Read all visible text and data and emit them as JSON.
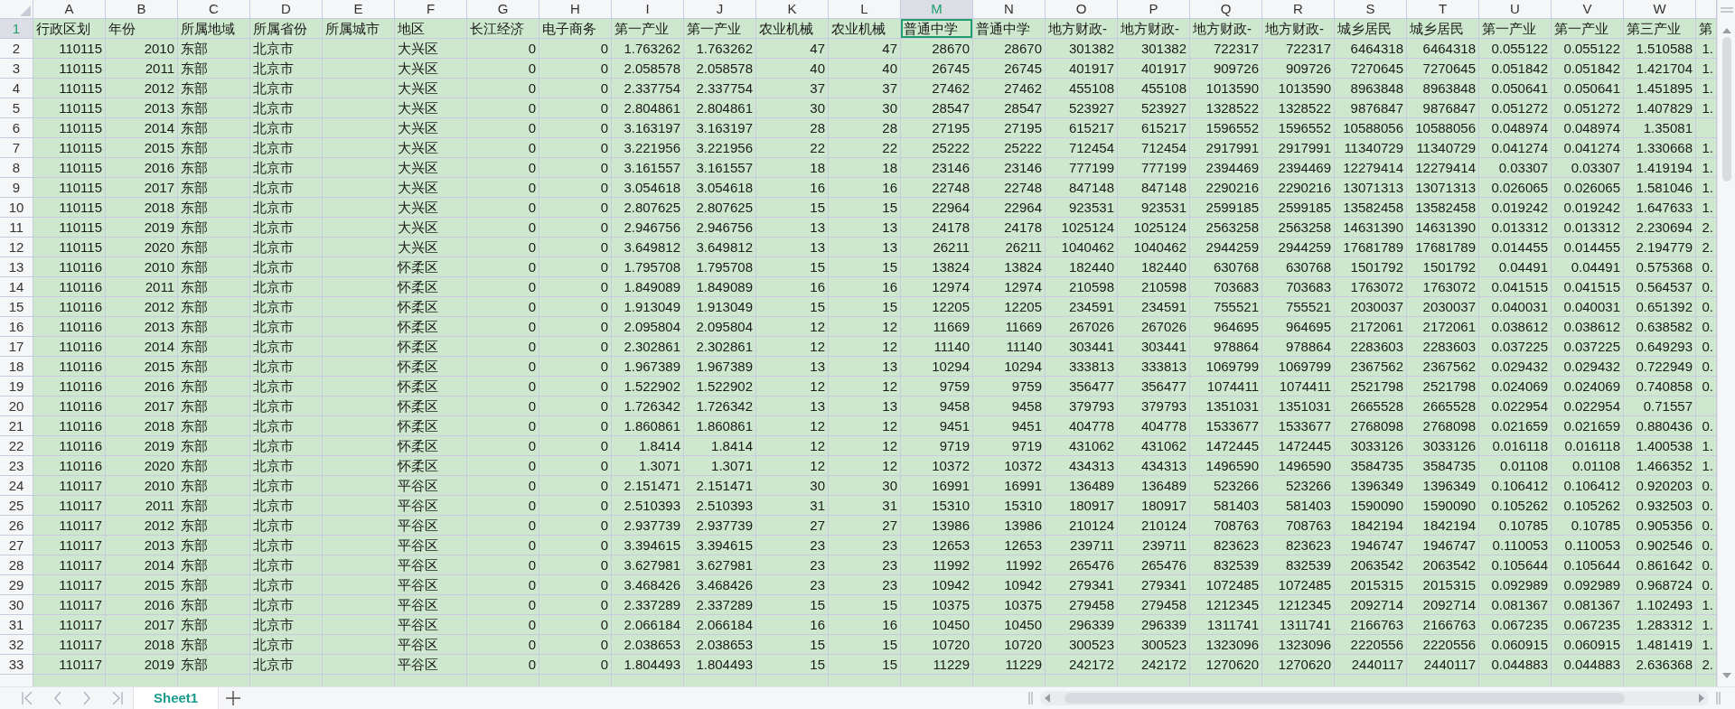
{
  "columns": [
    {
      "letter": "A",
      "kind": "number",
      "selected": false
    },
    {
      "letter": "B",
      "kind": "number",
      "selected": false
    },
    {
      "letter": "C",
      "kind": "text",
      "selected": false
    },
    {
      "letter": "D",
      "kind": "text",
      "selected": false
    },
    {
      "letter": "E",
      "kind": "text",
      "selected": false
    },
    {
      "letter": "F",
      "kind": "text",
      "selected": false
    },
    {
      "letter": "G",
      "kind": "number",
      "selected": false
    },
    {
      "letter": "H",
      "kind": "number",
      "selected": false
    },
    {
      "letter": "I",
      "kind": "number",
      "selected": false
    },
    {
      "letter": "J",
      "kind": "number",
      "selected": false
    },
    {
      "letter": "K",
      "kind": "number",
      "selected": false
    },
    {
      "letter": "L",
      "kind": "number",
      "selected": false
    },
    {
      "letter": "M",
      "kind": "number",
      "selected": true
    },
    {
      "letter": "N",
      "kind": "number",
      "selected": false
    },
    {
      "letter": "O",
      "kind": "number",
      "selected": false
    },
    {
      "letter": "P",
      "kind": "number",
      "selected": false
    },
    {
      "letter": "Q",
      "kind": "number",
      "selected": false
    },
    {
      "letter": "R",
      "kind": "number",
      "selected": false
    },
    {
      "letter": "S",
      "kind": "number",
      "selected": false
    },
    {
      "letter": "T",
      "kind": "number",
      "selected": false
    },
    {
      "letter": "U",
      "kind": "number",
      "selected": false
    },
    {
      "letter": "V",
      "kind": "number",
      "selected": false
    },
    {
      "letter": "W",
      "kind": "number",
      "selected": false
    },
    {
      "kind": "number",
      "selected": false
    }
  ],
  "rows": [
    {
      "number": "1",
      "kind": "header",
      "selected": true,
      "cells": [
        "行政区划",
        "年份",
        "所属地域",
        "所属省份",
        "所属城市",
        "地区",
        "长江经济",
        "电子商务",
        "第一产业",
        "第一产业",
        "农业机械",
        "农业机械",
        "普通中学",
        "普通中学",
        "地方财政-",
        "地方财政-",
        "地方财政-",
        "地方财政-",
        "城乡居民",
        "城乡居民",
        "第一产业",
        "第一产业",
        "第三产业",
        "第"
      ]
    },
    {
      "number": "2",
      "kind": "data",
      "selected": false,
      "cells": [
        "110115",
        "2010",
        "东部",
        "北京市",
        null,
        "大兴区",
        "0",
        "0",
        "1.763262",
        "1.763262",
        "47",
        "47",
        "28670",
        "28670",
        "301382",
        "301382",
        "722317",
        "722317",
        "6464318",
        "6464318",
        "0.055122",
        "0.055122",
        "1.510588",
        "1."
      ]
    },
    {
      "number": "3",
      "kind": "data",
      "selected": false,
      "cells": [
        "110115",
        "2011",
        "东部",
        "北京市",
        null,
        "大兴区",
        "0",
        "0",
        "2.058578",
        "2.058578",
        "40",
        "40",
        "26745",
        "26745",
        "401917",
        "401917",
        "909726",
        "909726",
        "7270645",
        "7270645",
        "0.051842",
        "0.051842",
        "1.421704",
        "1."
      ]
    },
    {
      "number": "4",
      "kind": "data",
      "selected": false,
      "cells": [
        "110115",
        "2012",
        "东部",
        "北京市",
        null,
        "大兴区",
        "0",
        "0",
        "2.337754",
        "2.337754",
        "37",
        "37",
        "27462",
        "27462",
        "455108",
        "455108",
        "1013590",
        "1013590",
        "8963848",
        "8963848",
        "0.050641",
        "0.050641",
        "1.451895",
        "1."
      ]
    },
    {
      "number": "5",
      "kind": "data",
      "selected": false,
      "cells": [
        "110115",
        "2013",
        "东部",
        "北京市",
        null,
        "大兴区",
        "0",
        "0",
        "2.804861",
        "2.804861",
        "30",
        "30",
        "28547",
        "28547",
        "523927",
        "523927",
        "1328522",
        "1328522",
        "9876847",
        "9876847",
        "0.051272",
        "0.051272",
        "1.407829",
        "1."
      ]
    },
    {
      "number": "6",
      "kind": "data",
      "selected": false,
      "cells": [
        "110115",
        "2014",
        "东部",
        "北京市",
        null,
        "大兴区",
        "0",
        "0",
        "3.163197",
        "3.163197",
        "28",
        "28",
        "27195",
        "27195",
        "615217",
        "615217",
        "1596552",
        "1596552",
        "10588056",
        "10588056",
        "0.048974",
        "0.048974",
        "1.35081",
        null
      ]
    },
    {
      "number": "7",
      "kind": "data",
      "selected": false,
      "cells": [
        "110115",
        "2015",
        "东部",
        "北京市",
        null,
        "大兴区",
        "0",
        "0",
        "3.221956",
        "3.221956",
        "22",
        "22",
        "25222",
        "25222",
        "712454",
        "712454",
        "2917991",
        "2917991",
        "11340729",
        "11340729",
        "0.041274",
        "0.041274",
        "1.330668",
        "1."
      ]
    },
    {
      "number": "8",
      "kind": "data",
      "selected": false,
      "cells": [
        "110115",
        "2016",
        "东部",
        "北京市",
        null,
        "大兴区",
        "0",
        "0",
        "3.161557",
        "3.161557",
        "18",
        "18",
        "23146",
        "23146",
        "777199",
        "777199",
        "2394469",
        "2394469",
        "12279414",
        "12279414",
        "0.03307",
        "0.03307",
        "1.419194",
        "1."
      ]
    },
    {
      "number": "9",
      "kind": "data",
      "selected": false,
      "cells": [
        "110115",
        "2017",
        "东部",
        "北京市",
        null,
        "大兴区",
        "0",
        "0",
        "3.054618",
        "3.054618",
        "16",
        "16",
        "22748",
        "22748",
        "847148",
        "847148",
        "2290216",
        "2290216",
        "13071313",
        "13071313",
        "0.026065",
        "0.026065",
        "1.581046",
        "1."
      ]
    },
    {
      "number": "10",
      "kind": "data",
      "selected": false,
      "cells": [
        "110115",
        "2018",
        "东部",
        "北京市",
        null,
        "大兴区",
        "0",
        "0",
        "2.807625",
        "2.807625",
        "15",
        "15",
        "22964",
        "22964",
        "923531",
        "923531",
        "2599185",
        "2599185",
        "13582458",
        "13582458",
        "0.019242",
        "0.019242",
        "1.647633",
        "1."
      ]
    },
    {
      "number": "11",
      "kind": "data",
      "selected": false,
      "cells": [
        "110115",
        "2019",
        "东部",
        "北京市",
        null,
        "大兴区",
        "0",
        "0",
        "2.946756",
        "2.946756",
        "13",
        "13",
        "24178",
        "24178",
        "1025124",
        "1025124",
        "2563258",
        "2563258",
        "14631390",
        "14631390",
        "0.013312",
        "0.013312",
        "2.230694",
        "2."
      ]
    },
    {
      "number": "12",
      "kind": "data",
      "selected": false,
      "cells": [
        "110115",
        "2020",
        "东部",
        "北京市",
        null,
        "大兴区",
        "0",
        "0",
        "3.649812",
        "3.649812",
        "13",
        "13",
        "26211",
        "26211",
        "1040462",
        "1040462",
        "2944259",
        "2944259",
        "17681789",
        "17681789",
        "0.014455",
        "0.014455",
        "2.194779",
        "2."
      ]
    },
    {
      "number": "13",
      "kind": "data",
      "selected": false,
      "cells": [
        "110116",
        "2010",
        "东部",
        "北京市",
        null,
        "怀柔区",
        "0",
        "0",
        "1.795708",
        "1.795708",
        "15",
        "15",
        "13824",
        "13824",
        "182440",
        "182440",
        "630768",
        "630768",
        "1501792",
        "1501792",
        "0.04491",
        "0.04491",
        "0.575368",
        "0."
      ]
    },
    {
      "number": "14",
      "kind": "data",
      "selected": false,
      "cells": [
        "110116",
        "2011",
        "东部",
        "北京市",
        null,
        "怀柔区",
        "0",
        "0",
        "1.849089",
        "1.849089",
        "16",
        "16",
        "12974",
        "12974",
        "210598",
        "210598",
        "703683",
        "703683",
        "1763072",
        "1763072",
        "0.041515",
        "0.041515",
        "0.564537",
        "0."
      ]
    },
    {
      "number": "15",
      "kind": "data",
      "selected": false,
      "cells": [
        "110116",
        "2012",
        "东部",
        "北京市",
        null,
        "怀柔区",
        "0",
        "0",
        "1.913049",
        "1.913049",
        "15",
        "15",
        "12205",
        "12205",
        "234591",
        "234591",
        "755521",
        "755521",
        "2030037",
        "2030037",
        "0.040031",
        "0.040031",
        "0.651392",
        "0."
      ]
    },
    {
      "number": "16",
      "kind": "data",
      "selected": false,
      "cells": [
        "110116",
        "2013",
        "东部",
        "北京市",
        null,
        "怀柔区",
        "0",
        "0",
        "2.095804",
        "2.095804",
        "12",
        "12",
        "11669",
        "11669",
        "267026",
        "267026",
        "964695",
        "964695",
        "2172061",
        "2172061",
        "0.038612",
        "0.038612",
        "0.638582",
        "0."
      ]
    },
    {
      "number": "17",
      "kind": "data",
      "selected": false,
      "cells": [
        "110116",
        "2014",
        "东部",
        "北京市",
        null,
        "怀柔区",
        "0",
        "0",
        "2.302861",
        "2.302861",
        "12",
        "12",
        "11140",
        "11140",
        "303441",
        "303441",
        "978864",
        "978864",
        "2283603",
        "2283603",
        "0.037225",
        "0.037225",
        "0.649293",
        "0."
      ]
    },
    {
      "number": "18",
      "kind": "data",
      "selected": false,
      "cells": [
        "110116",
        "2015",
        "东部",
        "北京市",
        null,
        "怀柔区",
        "0",
        "0",
        "1.967389",
        "1.967389",
        "13",
        "13",
        "10294",
        "10294",
        "333813",
        "333813",
        "1069799",
        "1069799",
        "2367562",
        "2367562",
        "0.029432",
        "0.029432",
        "0.722949",
        "0."
      ]
    },
    {
      "number": "19",
      "kind": "data",
      "selected": false,
      "cells": [
        "110116",
        "2016",
        "东部",
        "北京市",
        null,
        "怀柔区",
        "0",
        "0",
        "1.522902",
        "1.522902",
        "12",
        "12",
        "9759",
        "9759",
        "356477",
        "356477",
        "1074411",
        "1074411",
        "2521798",
        "2521798",
        "0.024069",
        "0.024069",
        "0.740858",
        "0."
      ]
    },
    {
      "number": "20",
      "kind": "data",
      "selected": false,
      "cells": [
        "110116",
        "2017",
        "东部",
        "北京市",
        null,
        "怀柔区",
        "0",
        "0",
        "1.726342",
        "1.726342",
        "13",
        "13",
        "9458",
        "9458",
        "379793",
        "379793",
        "1351031",
        "1351031",
        "2665528",
        "2665528",
        "0.022954",
        "0.022954",
        "0.71557",
        null
      ]
    },
    {
      "number": "21",
      "kind": "data",
      "selected": false,
      "cells": [
        "110116",
        "2018",
        "东部",
        "北京市",
        null,
        "怀柔区",
        "0",
        "0",
        "1.860861",
        "1.860861",
        "12",
        "12",
        "9451",
        "9451",
        "404778",
        "404778",
        "1533677",
        "1533677",
        "2768098",
        "2768098",
        "0.021659",
        "0.021659",
        "0.880436",
        "0."
      ]
    },
    {
      "number": "22",
      "kind": "data",
      "selected": false,
      "cells": [
        "110116",
        "2019",
        "东部",
        "北京市",
        null,
        "怀柔区",
        "0",
        "0",
        "1.8414",
        "1.8414",
        "12",
        "12",
        "9719",
        "9719",
        "431062",
        "431062",
        "1472445",
        "1472445",
        "3033126",
        "3033126",
        "0.016118",
        "0.016118",
        "1.400538",
        "1."
      ]
    },
    {
      "number": "23",
      "kind": "data",
      "selected": false,
      "cells": [
        "110116",
        "2020",
        "东部",
        "北京市",
        null,
        "怀柔区",
        "0",
        "0",
        "1.3071",
        "1.3071",
        "12",
        "12",
        "10372",
        "10372",
        "434313",
        "434313",
        "1496590",
        "1496590",
        "3584735",
        "3584735",
        "0.01108",
        "0.01108",
        "1.466352",
        "1."
      ]
    },
    {
      "number": "24",
      "kind": "data",
      "selected": false,
      "cells": [
        "110117",
        "2010",
        "东部",
        "北京市",
        null,
        "平谷区",
        "0",
        "0",
        "2.151471",
        "2.151471",
        "30",
        "30",
        "16991",
        "16991",
        "136489",
        "136489",
        "523266",
        "523266",
        "1396349",
        "1396349",
        "0.106412",
        "0.106412",
        "0.920203",
        "0."
      ]
    },
    {
      "number": "25",
      "kind": "data",
      "selected": false,
      "cells": [
        "110117",
        "2011",
        "东部",
        "北京市",
        null,
        "平谷区",
        "0",
        "0",
        "2.510393",
        "2.510393",
        "31",
        "31",
        "15310",
        "15310",
        "180917",
        "180917",
        "581403",
        "581403",
        "1590090",
        "1590090",
        "0.105262",
        "0.105262",
        "0.932503",
        "0."
      ]
    },
    {
      "number": "26",
      "kind": "data",
      "selected": false,
      "cells": [
        "110117",
        "2012",
        "东部",
        "北京市",
        null,
        "平谷区",
        "0",
        "0",
        "2.937739",
        "2.937739",
        "27",
        "27",
        "13986",
        "13986",
        "210124",
        "210124",
        "708763",
        "708763",
        "1842194",
        "1842194",
        "0.10785",
        "0.10785",
        "0.905356",
        "0."
      ]
    },
    {
      "number": "27",
      "kind": "data",
      "selected": false,
      "cells": [
        "110117",
        "2013",
        "东部",
        "北京市",
        null,
        "平谷区",
        "0",
        "0",
        "3.394615",
        "3.394615",
        "23",
        "23",
        "12653",
        "12653",
        "239711",
        "239711",
        "823623",
        "823623",
        "1946747",
        "1946747",
        "0.110053",
        "0.110053",
        "0.902546",
        "0."
      ]
    },
    {
      "number": "28",
      "kind": "data",
      "selected": false,
      "cells": [
        "110117",
        "2014",
        "东部",
        "北京市",
        null,
        "平谷区",
        "0",
        "0",
        "3.627981",
        "3.627981",
        "23",
        "23",
        "11992",
        "11992",
        "265476",
        "265476",
        "832539",
        "832539",
        "2063542",
        "2063542",
        "0.105644",
        "0.105644",
        "0.861642",
        "0."
      ]
    },
    {
      "number": "29",
      "kind": "data",
      "selected": false,
      "cells": [
        "110117",
        "2015",
        "东部",
        "北京市",
        null,
        "平谷区",
        "0",
        "0",
        "3.468426",
        "3.468426",
        "23",
        "23",
        "10942",
        "10942",
        "279341",
        "279341",
        "1072485",
        "1072485",
        "2015315",
        "2015315",
        "0.092989",
        "0.092989",
        "0.968724",
        "0."
      ]
    },
    {
      "number": "30",
      "kind": "data",
      "selected": false,
      "cells": [
        "110117",
        "2016",
        "东部",
        "北京市",
        null,
        "平谷区",
        "0",
        "0",
        "2.337289",
        "2.337289",
        "15",
        "15",
        "10375",
        "10375",
        "279458",
        "279458",
        "1212345",
        "1212345",
        "2092714",
        "2092714",
        "0.081367",
        "0.081367",
        "1.102493",
        "1."
      ]
    },
    {
      "number": "31",
      "kind": "data",
      "selected": false,
      "cells": [
        "110117",
        "2017",
        "东部",
        "北京市",
        null,
        "平谷区",
        "0",
        "0",
        "2.066184",
        "2.066184",
        "16",
        "16",
        "10450",
        "10450",
        "296339",
        "296339",
        "1311741",
        "1311741",
        "2166763",
        "2166763",
        "0.067235",
        "0.067235",
        "1.283312",
        "1."
      ]
    },
    {
      "number": "32",
      "kind": "data",
      "selected": false,
      "cells": [
        "110117",
        "2018",
        "东部",
        "北京市",
        null,
        "平谷区",
        "0",
        "0",
        "2.038653",
        "2.038653",
        "15",
        "15",
        "10720",
        "10720",
        "300523",
        "300523",
        "1323096",
        "1323096",
        "2220556",
        "2220556",
        "0.060915",
        "0.060915",
        "1.481419",
        "1."
      ]
    },
    {
      "number": "33",
      "kind": "data",
      "selected": false,
      "cells": [
        "110117",
        "2019",
        "东部",
        "北京市",
        null,
        "平谷区",
        "0",
        "0",
        "1.804493",
        "1.804493",
        "15",
        "15",
        "11229",
        "11229",
        "242172",
        "242172",
        "1270620",
        "1270620",
        "2440117",
        "2440117",
        "0.044883",
        "0.044883",
        "2.636368",
        "2."
      ]
    }
  ],
  "sheets": [
    {
      "name": "Sheet1",
      "selected": true
    }
  ]
}
